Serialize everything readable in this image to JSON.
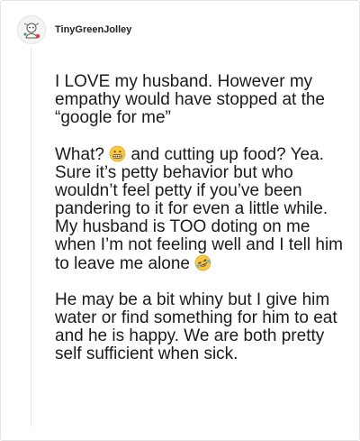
{
  "comment": {
    "username": "TinyGreenJolley",
    "paragraphs": [
      {
        "text_before": "I LOVE my husband. However my empathy would have stopped at the “google for me”"
      },
      {
        "text_before": "What? ",
        "emoji_1": "grimacing-face-emoji",
        "text_middle": " and cutting up food? Yea. Sure it’s petty behavior but who wouldn’t feel petty if you’ve been pandering to it for even a little while. My husband is TOO doting on me when I’m not feeling well and I tell him to leave me alone ",
        "emoji_2": "rolling-on-floor-laughing-emoji"
      },
      {
        "text_before": "He may be a bit whiny but I give him water or find something for him to eat and he is happy. We are both pretty self sufficient when sick."
      }
    ]
  },
  "colors": {
    "text": "#1b1b1b",
    "border": "#e4e4e4",
    "emoji_yellow": "#f7c843"
  }
}
